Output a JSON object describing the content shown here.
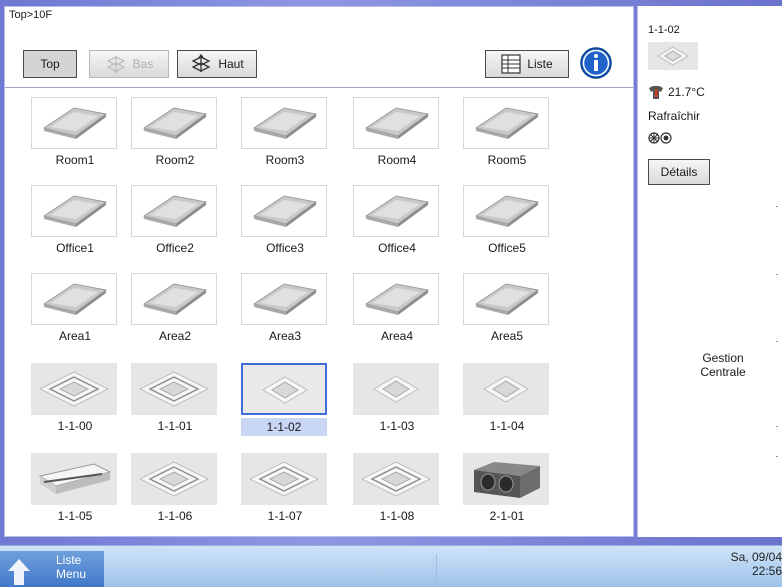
{
  "breadcrumb": "Top>10F",
  "toolbar": {
    "top_label": "Top",
    "bas_label": "Bas",
    "haut_label": "Haut",
    "liste_label": "Liste",
    "info_icon": "info-icon"
  },
  "grid": {
    "rows": [
      [
        {
          "label": "Room1",
          "type": "room"
        },
        {
          "label": "Room2",
          "type": "room"
        },
        {
          "label": "Room3",
          "type": "room"
        },
        {
          "label": "Room4",
          "type": "room"
        },
        {
          "label": "Room5",
          "type": "room"
        }
      ],
      [
        {
          "label": "Office1",
          "type": "room"
        },
        {
          "label": "Office2",
          "type": "room"
        },
        {
          "label": "Office3",
          "type": "room"
        },
        {
          "label": "Office4",
          "type": "room"
        },
        {
          "label": "Office5",
          "type": "room"
        }
      ],
      [
        {
          "label": "Area1",
          "type": "room"
        },
        {
          "label": "Area2",
          "type": "room"
        },
        {
          "label": "Area3",
          "type": "room"
        },
        {
          "label": "Area4",
          "type": "room"
        },
        {
          "label": "Area5",
          "type": "room"
        }
      ],
      [
        {
          "label": "1-1-00",
          "type": "cassette"
        },
        {
          "label": "1-1-01",
          "type": "cassette"
        },
        {
          "label": "1-1-02",
          "type": "cassette-small",
          "selected": true
        },
        {
          "label": "1-1-03",
          "type": "cassette-small"
        },
        {
          "label": "1-1-04",
          "type": "cassette-small"
        }
      ],
      [
        {
          "label": "1-1-05",
          "type": "ceiling"
        },
        {
          "label": "1-1-06",
          "type": "cassette"
        },
        {
          "label": "1-1-07",
          "type": "cassette"
        },
        {
          "label": "1-1-08",
          "type": "cassette"
        },
        {
          "label": "2-1-01",
          "type": "ducted"
        }
      ]
    ]
  },
  "side": {
    "unit_name": "1-1-02",
    "temperature": "21.7°C",
    "mode": "Rafraîchir",
    "details_label": "Détails",
    "gestion_line1": "Gestion",
    "gestion_line2": "Centrale"
  },
  "bottom": {
    "menu_line1": "Liste",
    "menu_line2": "Menu",
    "date": "Sa, 09/04",
    "time": "22:56"
  },
  "colors": {
    "accent": "#3b6fd6",
    "selected_bg": "#c9d6f4",
    "background": "#7e86d6"
  }
}
